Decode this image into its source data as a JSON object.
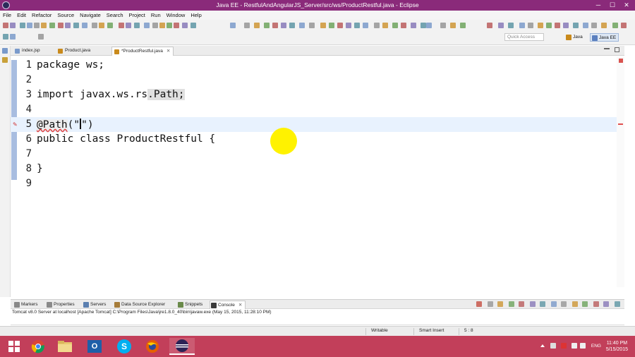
{
  "window": {
    "title": "Java EE - RestfulAndAngularJS_Server/src/ws/ProductRestful.java - Eclipse",
    "minimize": "─",
    "maximize": "☐",
    "close": "✕"
  },
  "menu": [
    "File",
    "Edit",
    "Refactor",
    "Source",
    "Navigate",
    "Search",
    "Project",
    "Run",
    "Window",
    "Help"
  ],
  "toolbar": {
    "quick_access_placeholder": "Quick Access",
    "perspectives": [
      {
        "label": "Java",
        "icon": "java-perspective-icon",
        "color": "#c98a1c"
      },
      {
        "label": "Java EE",
        "icon": "javaee-perspective-icon",
        "color": "#5a7fbf"
      }
    ]
  },
  "editor_tabs": [
    {
      "label": "index.jsp",
      "icon": "jsp-file-icon",
      "color": "#7a9acb",
      "active": false
    },
    {
      "label": "Product.java",
      "icon": "java-file-icon",
      "color": "#c98a1c",
      "active": false
    },
    {
      "label": "*ProductRestful.java",
      "icon": "java-file-icon",
      "color": "#c98a1c",
      "active": true,
      "close": "✕"
    }
  ],
  "code_lines": [
    {
      "num": "1",
      "text": "package ws;"
    },
    {
      "num": "2",
      "text": ""
    },
    {
      "num": "3",
      "pre": "import javax.ws.rs",
      "hl": ".Path;"
    },
    {
      "num": "4",
      "text": ""
    },
    {
      "num": "5",
      "annot": "@Path",
      "post1": "(\"",
      "post2": "\")",
      "current": true
    },
    {
      "num": "6",
      "text": "public class ProductRestful {"
    },
    {
      "num": "7",
      "text": ""
    },
    {
      "num": "8",
      "text": "}"
    },
    {
      "num": "9",
      "text": ""
    }
  ],
  "bottom_tabs": [
    {
      "label": "Markers",
      "icon": "markers-icon",
      "color": "#888888"
    },
    {
      "label": "Properties",
      "icon": "properties-icon",
      "color": "#8a8a8a"
    },
    {
      "label": "Servers",
      "icon": "servers-icon",
      "color": "#5b7fb0"
    },
    {
      "label": "Data Source Explorer",
      "icon": "data-source-icon",
      "color": "#a67c3a"
    },
    {
      "label": "Snippets",
      "icon": "snippets-icon",
      "color": "#6a8a4a"
    },
    {
      "label": "Console",
      "icon": "console-icon",
      "color": "#3a3a3a",
      "active": true,
      "close": "✕"
    }
  ],
  "console": {
    "description": "Tomcat v8.0 Server at localhost [Apache Tomcat] C:\\Program Files\\Java\\jre1.8.0_40\\bin\\javaw.exe (May 15, 2015, 11:28:10 PM)"
  },
  "status": {
    "writable": "Writable",
    "insert_mode": "Smart Insert",
    "position": "5 : 8"
  },
  "taskbar": {
    "apps": [
      {
        "name": "start-button",
        "icon": "windows-logo-icon"
      },
      {
        "name": "chrome",
        "icon": "chrome-icon"
      },
      {
        "name": "file-explorer",
        "icon": "folder-icon"
      },
      {
        "name": "outlook",
        "icon": "outlook-icon",
        "glyph": "O"
      },
      {
        "name": "skype",
        "icon": "skype-icon",
        "glyph": "S"
      },
      {
        "name": "firefox",
        "icon": "firefox-icon"
      },
      {
        "name": "eclipse",
        "icon": "eclipse-icon",
        "active": true
      }
    ],
    "language": "ENG",
    "time": "11:40 PM",
    "date": "5/15/2015"
  }
}
